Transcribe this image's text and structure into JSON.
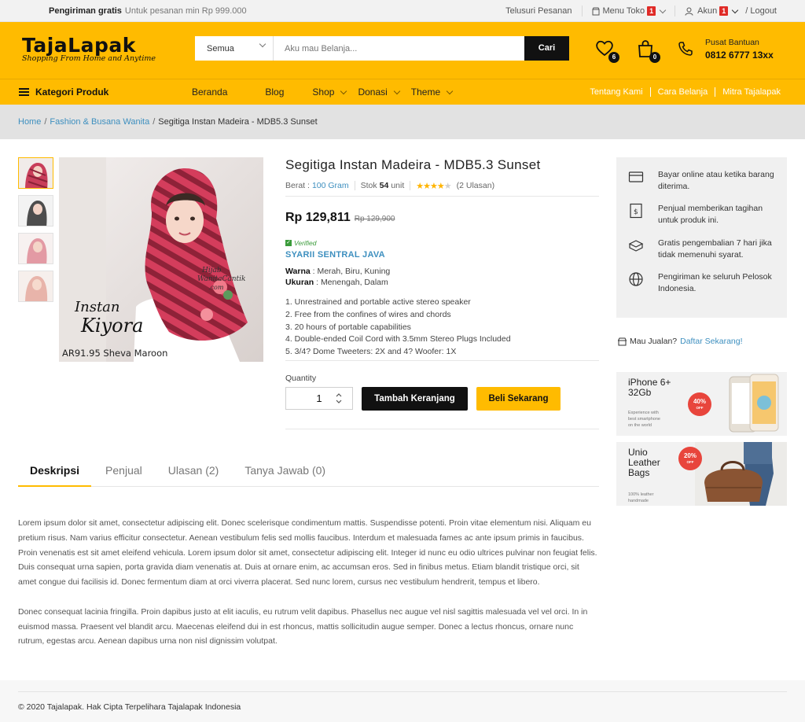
{
  "topbar": {
    "shipping_bold": "Pengiriman gratis",
    "shipping_text": "Untuk pesanan min Rp 999.000",
    "track": "Telusuri Pesanan",
    "store_menu": "Menu Toko",
    "store_badge": "1",
    "account": "Akun",
    "account_badge": "1",
    "logout": "/ Logout"
  },
  "header": {
    "logo_name": "TajaLapak",
    "logo_tagline": "Shopping From Home and Anytime",
    "search_category": "Semua",
    "search_placeholder": "Aku mau Belanja...",
    "search_button": "Cari",
    "wishlist_count": "6",
    "cart_count": "0",
    "support_label": "Pusat Bantuan",
    "support_phone": "0812 6777 13xx",
    "accent_color": "#ffbb00"
  },
  "nav": {
    "category_button": "Kategori Produk",
    "items": [
      {
        "label": "Beranda"
      },
      {
        "label": "Blog"
      },
      {
        "label": "Shop"
      },
      {
        "label": "Donasi"
      },
      {
        "label": "Theme"
      }
    ],
    "right_links": [
      {
        "label": "Tentang Kami"
      },
      {
        "label": "Cara Belanja"
      },
      {
        "label": "Mitra Tajalapak"
      }
    ]
  },
  "breadcrumb": {
    "home": "Home",
    "category": "Fashion & Busana Wanita",
    "current": "Segitiga Instan Madeira - MDB5.3 Sunset"
  },
  "gallery": {
    "image_text_title": "Instan",
    "image_text_title2": "Kiyora",
    "image_caption": "AR91.95 Sheva Maroon",
    "watermark_1": "Hijab",
    "watermark_2": "WanitaCantik",
    "watermark_3": ".com"
  },
  "product": {
    "title": "Segitiga Instan Madeira - MDB5.3 Sunset",
    "weight_label": "Berat :",
    "weight_value": "100 Gram",
    "stock_label": "Stok",
    "stock_value": "54",
    "stock_unit": "unit",
    "rating": 4,
    "rating_max": 5,
    "reviews": "(2 Ulasan)",
    "price": "Rp 129,811",
    "old_price": "Rp 129,900",
    "verified": "Verified",
    "seller": "SYARII SENTRAL JAVA",
    "color_label": "Warna",
    "color_value": " : Merah, Biru, Kuning",
    "size_label": "Ukuran",
    "size_value": " : Menengah, Dalam",
    "features": [
      "1. Unrestrained and portable active stereo speaker",
      "2. Free from the confines of wires and chords",
      "3. 20 hours of portable capabilities",
      "4. Double-ended Coil Cord with 3.5mm Stereo Plugs Included",
      "5. 3/4? Dome Tweeters: 2X and 4? Woofer: 1X"
    ],
    "quantity_label": "Quantity",
    "quantity_value": "1",
    "add_to_cart": "Tambah Keranjang",
    "buy_now": "Beli Sekarang"
  },
  "sidebar": {
    "info": [
      {
        "icon": "card-icon",
        "text": "Bayar online atau ketika barang diterima."
      },
      {
        "icon": "invoice-icon",
        "text": "Penjual memberikan tagihan untuk produk ini."
      },
      {
        "icon": "return-box-icon",
        "text": "Gratis pengembalian 7 hari jika tidak memenuhi syarat."
      },
      {
        "icon": "globe-icon",
        "text": "Pengiriman ke seluruh Pelosok Indonesia."
      }
    ],
    "sell_text": "Mau Jualan?",
    "sell_link": "Daftar Sekarang!",
    "banners": [
      {
        "title_1": "iPhone 6+",
        "title_2": "32Gb",
        "sub_1": "Experience with",
        "sub_2": "best smartphone",
        "sub_3": "on the world",
        "pct": "40%",
        "off": "OFF"
      },
      {
        "title_1": "Unio",
        "title_2": "Leather",
        "title_3": "Bags",
        "sub_1": "100% leather",
        "sub_2": "handmade",
        "pct": "20%",
        "off": "OFF"
      }
    ]
  },
  "tabs": [
    {
      "label": "Deskripsi"
    },
    {
      "label": "Penjual"
    },
    {
      "label": "Ulasan (2)"
    },
    {
      "label": "Tanya Jawab (0)"
    }
  ],
  "description": [
    "Lorem ipsum dolor sit amet, consectetur adipiscing elit. Donec scelerisque condimentum mattis. Suspendisse potenti. Proin vitae elementum nisi. Aliquam eu pretium risus. Nam varius efficitur consectetur. Aenean vestibulum felis sed mollis faucibus. Interdum et malesuada fames ac ante ipsum primis in faucibus. Proin venenatis est sit amet eleifend vehicula. Lorem ipsum dolor sit amet, consectetur adipiscing elit. Integer id nunc eu odio ultrices pulvinar non feugiat felis. Duis consequat urna sapien, porta gravida diam venenatis at. Duis at ornare enim, ac accumsan eros. Sed in finibus metus. Etiam blandit tristique orci, sit amet congue dui facilisis id. Donec fermentum diam at orci viverra placerat. Sed nunc lorem, cursus nec vestibulum hendrerit, tempus et libero.",
    "Donec consequat lacinia fringilla. Proin dapibus justo at elit iaculis, eu rutrum velit dapibus. Phasellus nec augue vel nisl sagittis malesuada vel vel orci. In in euismod massa. Praesent vel blandit arcu. Maecenas eleifend dui in est rhoncus, mattis sollicitudin augue semper. Donec a lectus rhoncus, ornare nunc rutrum, egestas arcu. Aenean dapibus urna non nisl dignissim volutpat."
  ],
  "footer": {
    "copyright": "© 2020 Tajalapak. Hak Cipta Terpelihara Tajalapak Indonesia"
  }
}
